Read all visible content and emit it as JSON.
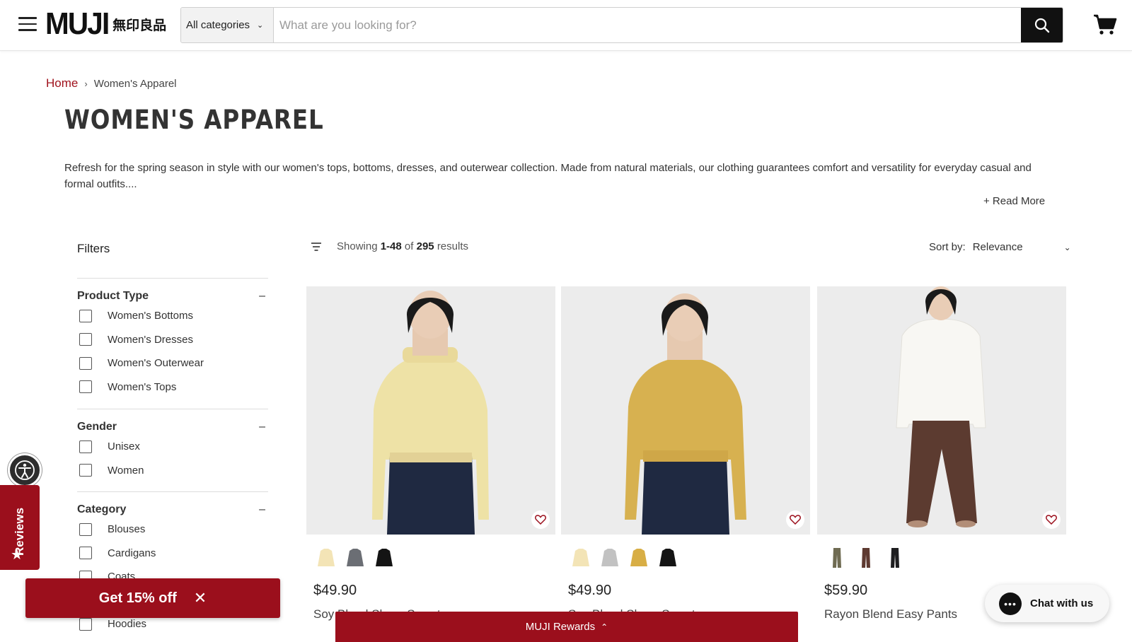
{
  "header": {
    "logo_main": "MUJI",
    "logo_sub": "無印良品",
    "category_select": "All categories",
    "search_placeholder": "What are you looking for?"
  },
  "breadcrumb": {
    "home": "Home",
    "separator": "›",
    "current": "Women's Apparel"
  },
  "page": {
    "title": "WOMEN'S APPAREL",
    "description": "Refresh for the spring season in style with our women's tops, bottoms, dresses, and outerwear collection. Made from natural materials, our clothing guarantees comfort and versatility for everyday casual and formal outfits....",
    "read_more": "+ Read More"
  },
  "filters": {
    "title": "Filters",
    "groups": [
      {
        "label": "Product Type",
        "toggle": "–",
        "options": [
          "Women's Bottoms",
          "Women's Dresses",
          "Women's Outerwear",
          "Women's Tops"
        ]
      },
      {
        "label": "Gender",
        "toggle": "–",
        "options": [
          "Unisex",
          "Women"
        ]
      },
      {
        "label": "Category",
        "toggle": "–",
        "options": [
          "Blouses",
          "Cardigans",
          "Coats",
          "",
          "Hoodies"
        ]
      }
    ]
  },
  "results": {
    "prefix": "Showing",
    "range": "1-48",
    "of": "of",
    "total": "295",
    "suffix": "results"
  },
  "sort": {
    "label": "Sort by:",
    "value": "Relevance"
  },
  "products": [
    {
      "price": "$49.90",
      "name": "Soy Blend Sheer Sweater",
      "swatches": [
        "#f3e4b6",
        "#6b6e74",
        "#141414"
      ],
      "body_color": "#f0e3a8",
      "pants_color": "#1e2840",
      "model": "turtleneck"
    },
    {
      "price": "$49.90",
      "name": "Soy Blend Sheer Sweater",
      "swatches": [
        "#f3e4b6",
        "#c2c2c2",
        "#d8ae45",
        "#141414"
      ],
      "body_color": "#d9b455",
      "pants_color": "#1e2840",
      "model": "crewneck"
    },
    {
      "price": "$59.90",
      "name": "Rayon Blend Easy Pants",
      "swatches": [
        "#6f6b52",
        "#5e3a31",
        "#1e1e20"
      ],
      "body_color": "#f7f6f2",
      "pants_color": "#5c3b30",
      "model": "shirt"
    }
  ],
  "overlays": {
    "reviews": "Reviews",
    "promo": "Get 15% off",
    "rewards": "MUJI Rewards",
    "chat": "Chat with us"
  },
  "colors": {
    "brand_red": "#9b0f1c",
    "link_red": "#a0121d"
  }
}
